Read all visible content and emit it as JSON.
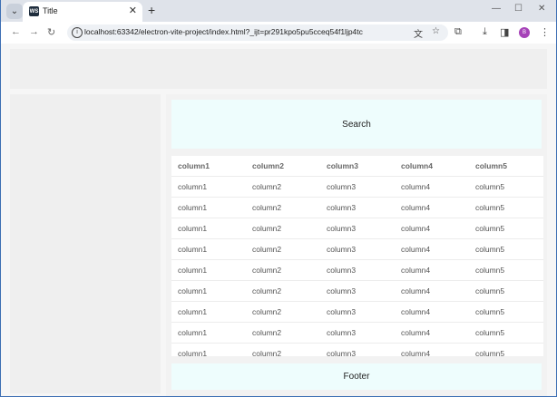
{
  "browser": {
    "tab_title": "Title",
    "tab_favicon_text": "WS",
    "url": "localhost:63342/electron-vite-project/index.html?_ijt=pr291kpo5pu5cceq54f1ljp4tc",
    "profile_initial": "B",
    "accent_color": "#a642b8"
  },
  "main": {
    "search_label": "Search",
    "footer_label": "Footer"
  },
  "table": {
    "headers": [
      "column1",
      "column2",
      "column3",
      "column4",
      "column5"
    ],
    "rows": [
      [
        "column1",
        "column2",
        "column3",
        "column4",
        "column5"
      ],
      [
        "column1",
        "column2",
        "column3",
        "column4",
        "column5"
      ],
      [
        "column1",
        "column2",
        "column3",
        "column4",
        "column5"
      ],
      [
        "column1",
        "column2",
        "column3",
        "column4",
        "column5"
      ],
      [
        "column1",
        "column2",
        "column3",
        "column4",
        "column5"
      ],
      [
        "column1",
        "column2",
        "column3",
        "column4",
        "column5"
      ],
      [
        "column1",
        "column2",
        "column3",
        "column4",
        "column5"
      ],
      [
        "column1",
        "column2",
        "column3",
        "column4",
        "column5"
      ],
      [
        "column1",
        "column2",
        "column3",
        "column4",
        "column5"
      ]
    ]
  }
}
